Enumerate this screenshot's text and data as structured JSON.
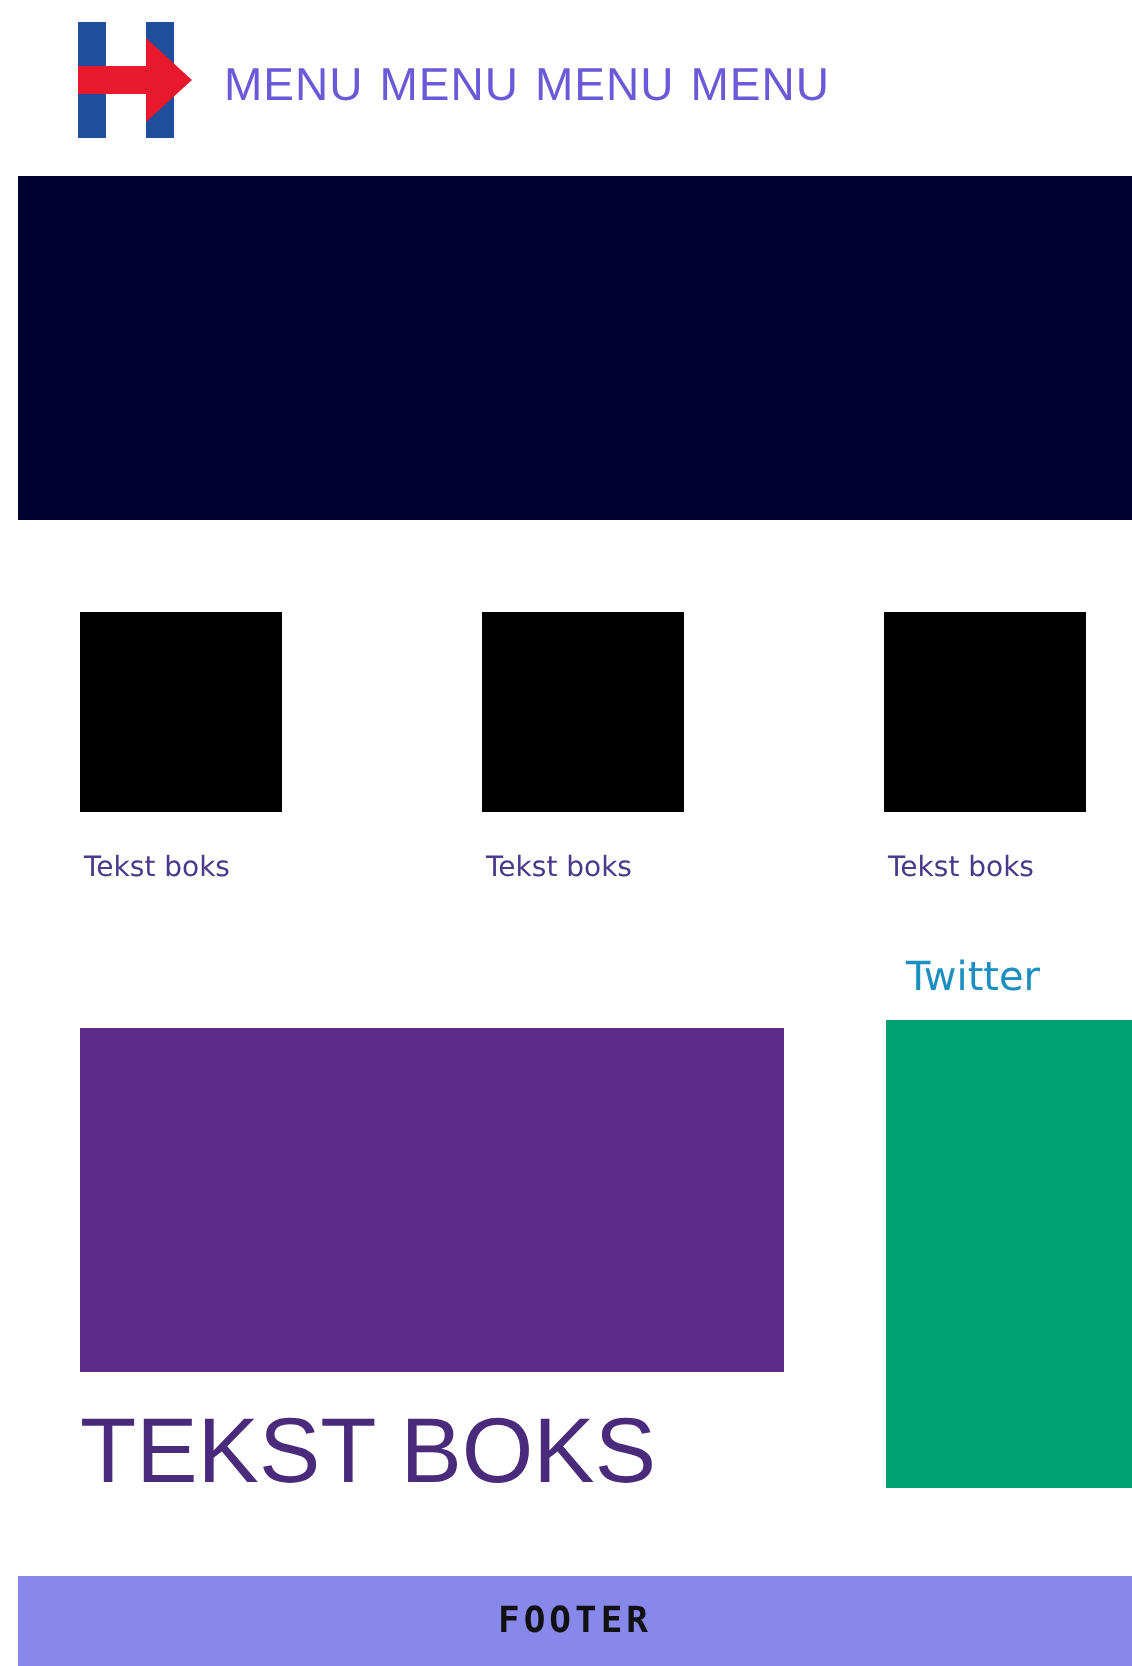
{
  "header": {
    "menu": [
      "MENU",
      "MENU",
      "MENU",
      "MENU"
    ]
  },
  "features": [
    {
      "caption": "Tekst boks"
    },
    {
      "caption": "Tekst boks"
    },
    {
      "caption": "Tekst boks"
    }
  ],
  "twitter": {
    "title": "Twitter"
  },
  "main": {
    "heading": "TEKST BOKS"
  },
  "footer": {
    "text": "FOOTER"
  }
}
